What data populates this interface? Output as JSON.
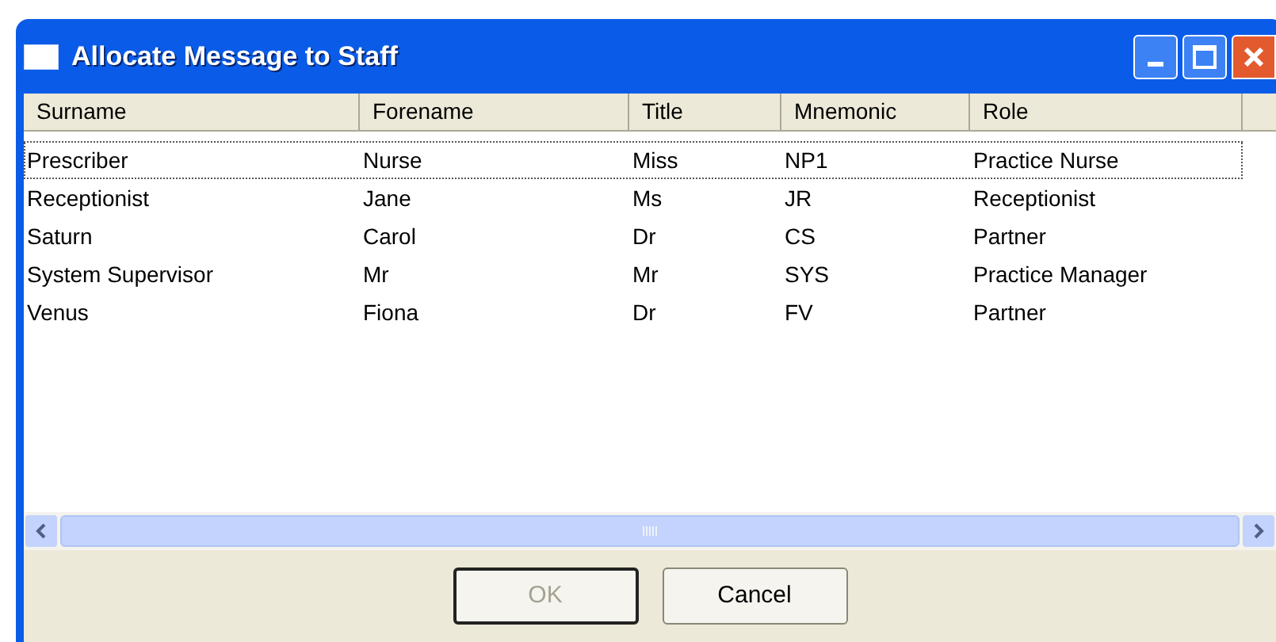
{
  "window": {
    "title": "Allocate Message to Staff"
  },
  "table": {
    "columns": [
      "Surname",
      "Forename",
      "Title",
      "Mnemonic",
      "Role"
    ],
    "rows": [
      {
        "cells": [
          "Prescriber",
          "Nurse",
          "Miss",
          "NP1",
          "Practice Nurse"
        ],
        "focused": true
      },
      {
        "cells": [
          "Receptionist",
          "Jane",
          "Ms",
          "JR",
          "Receptionist"
        ],
        "focused": false
      },
      {
        "cells": [
          "Saturn",
          "Carol",
          "Dr",
          "CS",
          "Partner"
        ],
        "focused": false
      },
      {
        "cells": [
          "System Supervisor",
          "Mr",
          "Mr",
          "SYS",
          "Practice Manager"
        ],
        "focused": false
      },
      {
        "cells": [
          "Venus",
          "Fiona",
          "Dr",
          "FV",
          "Partner"
        ],
        "focused": false
      }
    ]
  },
  "buttons": [
    {
      "label": "OK",
      "disabled": true
    },
    {
      "label": "Cancel",
      "disabled": false
    }
  ]
}
